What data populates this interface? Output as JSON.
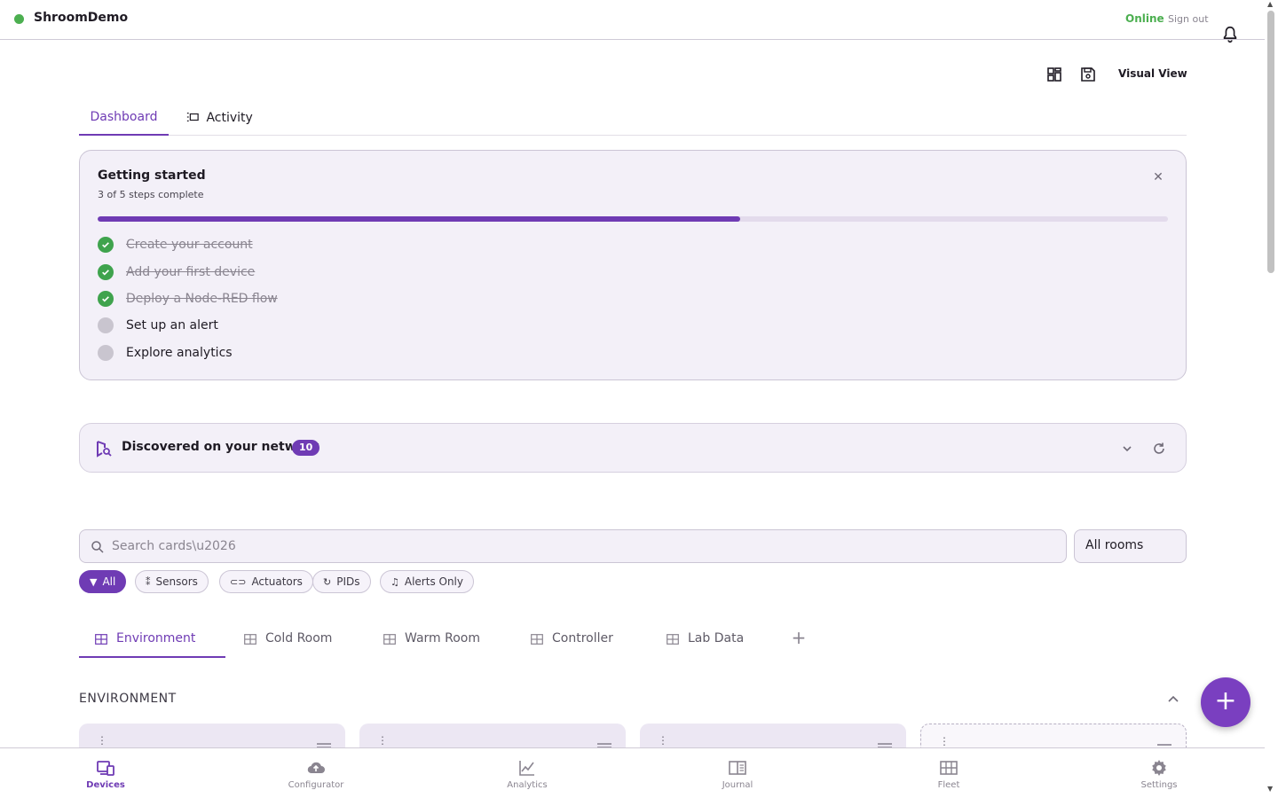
{
  "app": {
    "name": "ShroomDemo",
    "status": "Online",
    "sign_out": "Sign out"
  },
  "header": {
    "visual_view": "Visual View",
    "icons": [
      "layout-icon",
      "save-icon",
      "bell-icon"
    ]
  },
  "main_tabs": [
    {
      "label": "Dashboard",
      "active": true
    },
    {
      "label": "Activity",
      "active": false
    }
  ],
  "getting_started": {
    "title": "Getting started",
    "subtitle": "3 of 5 steps complete",
    "progress": 0.6,
    "steps": [
      {
        "label": "Create your account",
        "done": true
      },
      {
        "label": "Add your first device",
        "done": true
      },
      {
        "label": "Deploy a Node-RED flow",
        "done": true
      },
      {
        "label": "Set up an alert",
        "done": false
      },
      {
        "label": "Explore analytics",
        "done": false
      }
    ]
  },
  "discovered": {
    "title": "Discovered on your network",
    "count": "10"
  },
  "search": {
    "placeholder": "Search cards\\u2026",
    "rooms_select": "All rooms"
  },
  "filters": [
    {
      "label": "All",
      "icon": "filter-icon",
      "active": true
    },
    {
      "label": "Sensors",
      "icon": "sensor-icon",
      "active": false
    },
    {
      "label": "Actuators",
      "icon": "toggle-icon",
      "active": false
    },
    {
      "label": "PIDs",
      "icon": "loop-icon",
      "active": false
    },
    {
      "label": "Alerts Only",
      "icon": "bell-icon",
      "active": false
    }
  ],
  "room_tabs": [
    {
      "label": "Environment",
      "active": true
    },
    {
      "label": "Cold Room",
      "active": false
    },
    {
      "label": "Warm Room",
      "active": false
    },
    {
      "label": "Controller",
      "active": false
    },
    {
      "label": "Lab Data",
      "active": false
    }
  ],
  "section": {
    "title": "ENVIRONMENT"
  },
  "bottom_nav": [
    {
      "label": "Devices",
      "icon": "devices-icon",
      "active": true
    },
    {
      "label": "Configurator",
      "icon": "cloud-upload-icon",
      "active": false
    },
    {
      "label": "Analytics",
      "icon": "chart-icon",
      "active": false
    },
    {
      "label": "Journal",
      "icon": "book-icon",
      "active": false
    },
    {
      "label": "Fleet",
      "icon": "grid-icon",
      "active": false
    },
    {
      "label": "Settings",
      "icon": "gear-icon",
      "active": false
    }
  ],
  "colors": {
    "accent": "#6f3bb4",
    "success": "#4caf50",
    "card_bg": "#f3f0f8"
  }
}
